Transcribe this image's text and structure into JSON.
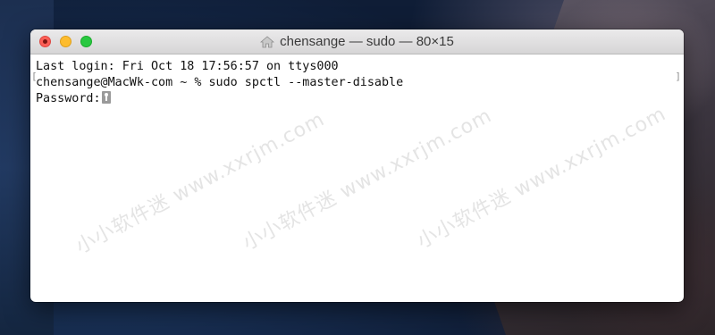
{
  "window": {
    "title": "chensange — sudo — 80×15",
    "title_icon": "home-folder-icon"
  },
  "terminal": {
    "lines": [
      "Last login: Fri Oct 18 17:56:57 on ttys000",
      "chensange@MacWk-com ~ % sudo spctl --master-disable",
      "Password:"
    ],
    "password_cursor_icon": "key-icon"
  },
  "watermark": {
    "text": "小小软件迷 www.xxrjm.com"
  },
  "colors": {
    "close": "#fc5f57",
    "minimize": "#fdbc2e",
    "zoom": "#28c840"
  }
}
